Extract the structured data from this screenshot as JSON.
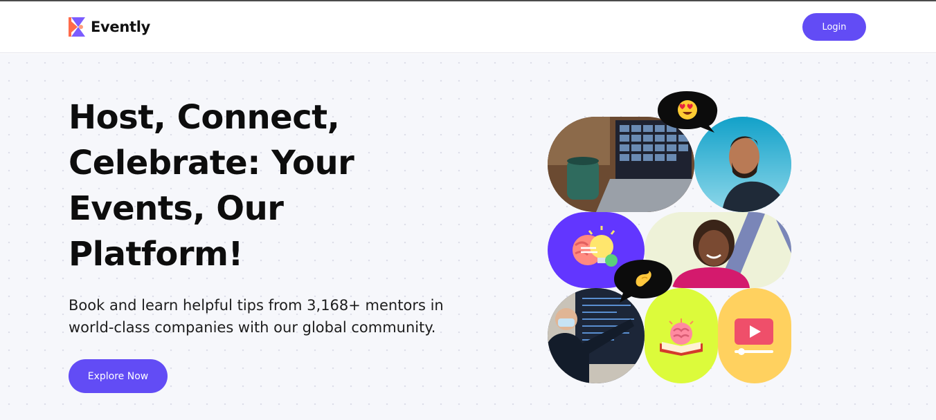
{
  "brand": {
    "name": "Evently",
    "logo_icon": "evently-logo-icon"
  },
  "header": {
    "login_label": "Login"
  },
  "hero": {
    "headline": "Host, Connect, Celebrate: Your Events, Our Platform!",
    "subtext": "Book and learn helpful tips from 3,168+ mentors in world-class companies with our global community.",
    "cta_label": "Explore Now"
  },
  "collage": {
    "tiles": [
      {
        "name": "video-call-photo",
        "icon": "laptop-video-call-image"
      },
      {
        "name": "smiling-man-photo",
        "icon": "smiling-man-image"
      },
      {
        "name": "brain-idea-tile",
        "icon": "brain-lightbulb-icon"
      },
      {
        "name": "smiling-woman-photo",
        "icon": "smiling-woman-image"
      },
      {
        "name": "lecture-photo",
        "icon": "presenter-image"
      },
      {
        "name": "book-brain-tile",
        "icon": "book-brain-icon"
      },
      {
        "name": "video-play-tile",
        "icon": "video-play-icon"
      }
    ],
    "bubbles": [
      {
        "name": "heart-eyes-bubble",
        "icon": "heart-eyes-emoji-icon"
      },
      {
        "name": "pinch-hand-bubble",
        "icon": "pinching-hand-emoji-icon"
      }
    ]
  },
  "colors": {
    "accent": "#624cf5",
    "hero_bg": "#f6f7fb",
    "lime": "#dcfb3b",
    "yellow": "#ffd15f"
  }
}
